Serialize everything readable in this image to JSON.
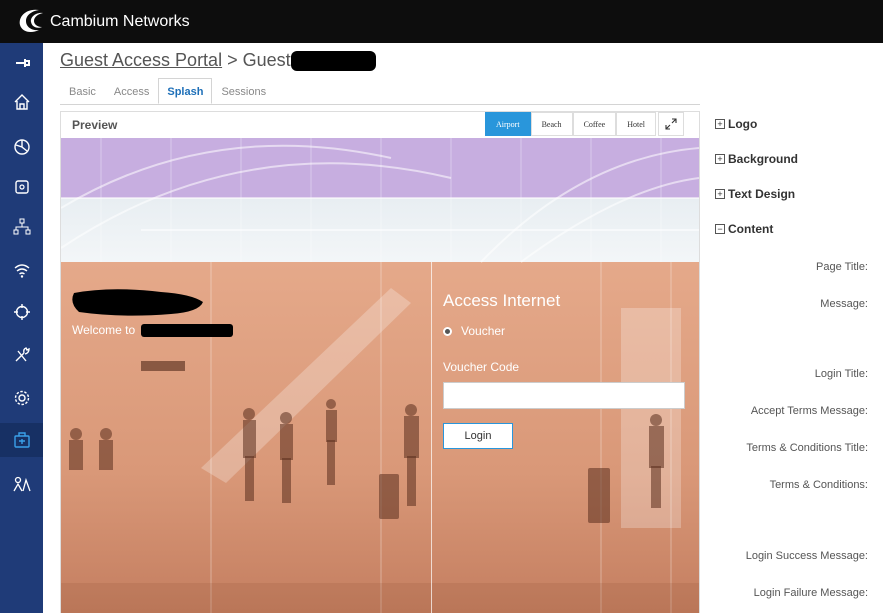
{
  "app": {
    "brand": "Cambium Networks"
  },
  "breadcrumb": {
    "portal": "Guest Access Portal",
    "separator": ">",
    "current": "Guest"
  },
  "tabs": [
    {
      "label": "Basic"
    },
    {
      "label": "Access"
    },
    {
      "label": "Splash",
      "active": true
    },
    {
      "label": "Sessions"
    }
  ],
  "preview": {
    "title": "Preview",
    "themes": [
      "Airport",
      "Beach",
      "Coffee",
      "Hotel"
    ],
    "selected_theme": "Airport",
    "welcome": "Welcome to",
    "access_title": "Access Internet",
    "voucher_option": "Voucher",
    "voucher_code_label": "Voucher Code",
    "voucher_code_value": "",
    "login_button": "Login"
  },
  "settings": {
    "sections": [
      {
        "label": "Logo",
        "expanded": false
      },
      {
        "label": "Background",
        "expanded": false
      },
      {
        "label": "Text Design",
        "expanded": false
      },
      {
        "label": "Content",
        "expanded": true
      }
    ],
    "content_fields": [
      "Page Title:",
      "Message:",
      "Login Title:",
      "Accept Terms Message:",
      "Terms & Conditions Title:",
      "Terms & Conditions:",
      "Login Success Message:",
      "Login Failure Message:"
    ]
  },
  "sidebar_icons": [
    "pin-icon",
    "home-icon",
    "dashboard-icon",
    "device-icon",
    "network-icon",
    "wifi-icon",
    "target-icon",
    "tools-icon",
    "settings-icon",
    "guest-icon",
    "users-icon"
  ],
  "colors": {
    "accent": "#2996db",
    "sidebar": "#1f3b78",
    "topbar": "#0d0d0d"
  }
}
